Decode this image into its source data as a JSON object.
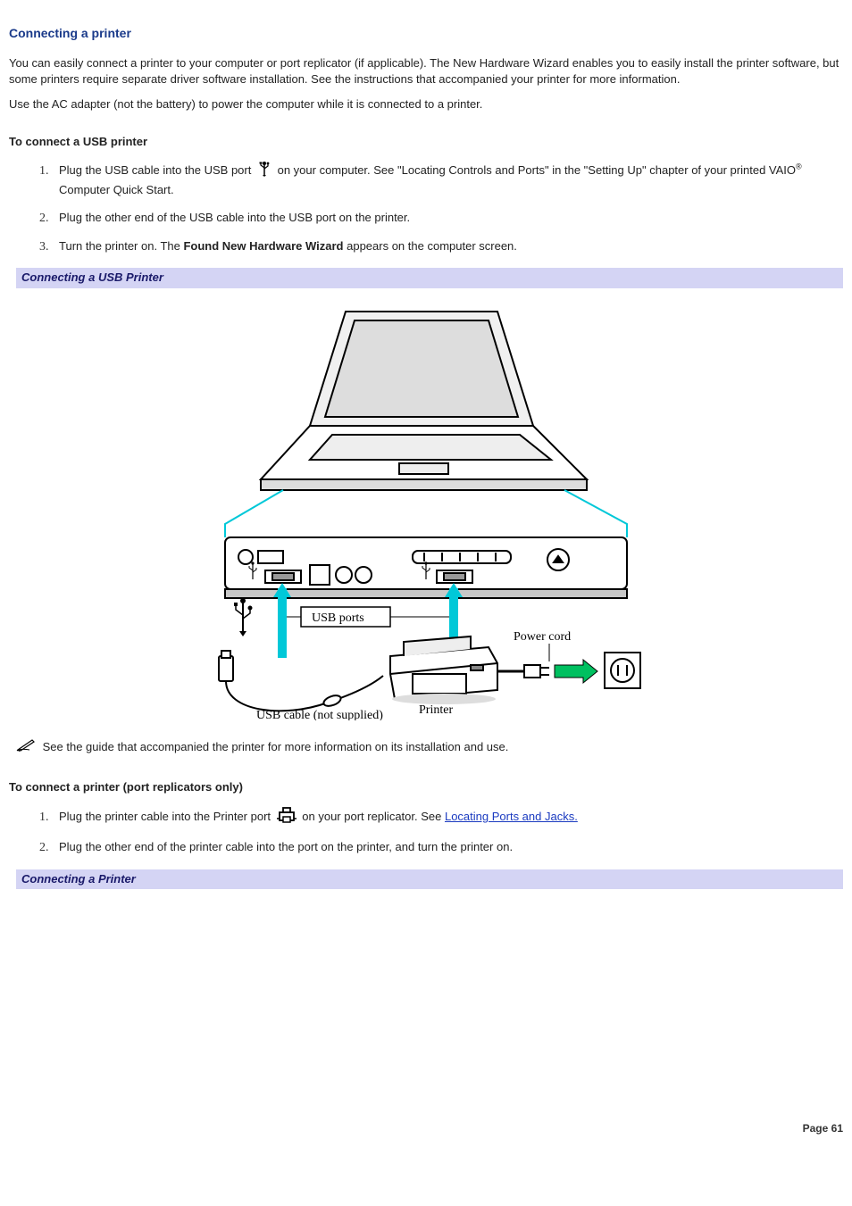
{
  "title": "Connecting a printer",
  "intro1": "You can easily connect a printer to your computer or port replicator (if applicable). The New Hardware Wizard enables you to easily install the printer software, but some printers require separate driver software installation. See the instructions that accompanied your printer for more information.",
  "intro2": "Use the AC adapter (not the battery) to power the computer while it is connected to a printer.",
  "usb_heading": "To connect a USB printer",
  "usb_steps": {
    "s1a": "Plug the USB cable into the USB port ",
    "s1b": " on your computer. See \"Locating Controls and Ports\" in the \"Setting Up\" chapter of your printed VAIO",
    "s1c": " Computer Quick Start.",
    "s2": "Plug the other end of the USB cable into the USB port on the printer.",
    "s3a": "Turn the printer on. The ",
    "s3b": "Found New Hardware Wizard",
    "s3c": " appears on the computer screen."
  },
  "caption1": "Connecting a USB Printer",
  "figure_labels": {
    "usb_ports": "USB ports",
    "power_cord": "Power cord",
    "printer": "Printer",
    "usb_cable": "USB cable (not supplied)"
  },
  "note1": "See the guide that accompanied the printer for more information on its installation and use.",
  "port_heading": "To connect a printer (port replicators only)",
  "port_steps": {
    "s1a": "Plug the printer cable into the Printer port ",
    "s1b": " on your port replicator. See ",
    "s1link": "Locating Ports and Jacks.",
    "s2": "Plug the other end of the printer cable into the port on the printer, and turn the printer on."
  },
  "caption2": "Connecting a Printer",
  "page_number": "Page 61",
  "reg_mark": "®"
}
